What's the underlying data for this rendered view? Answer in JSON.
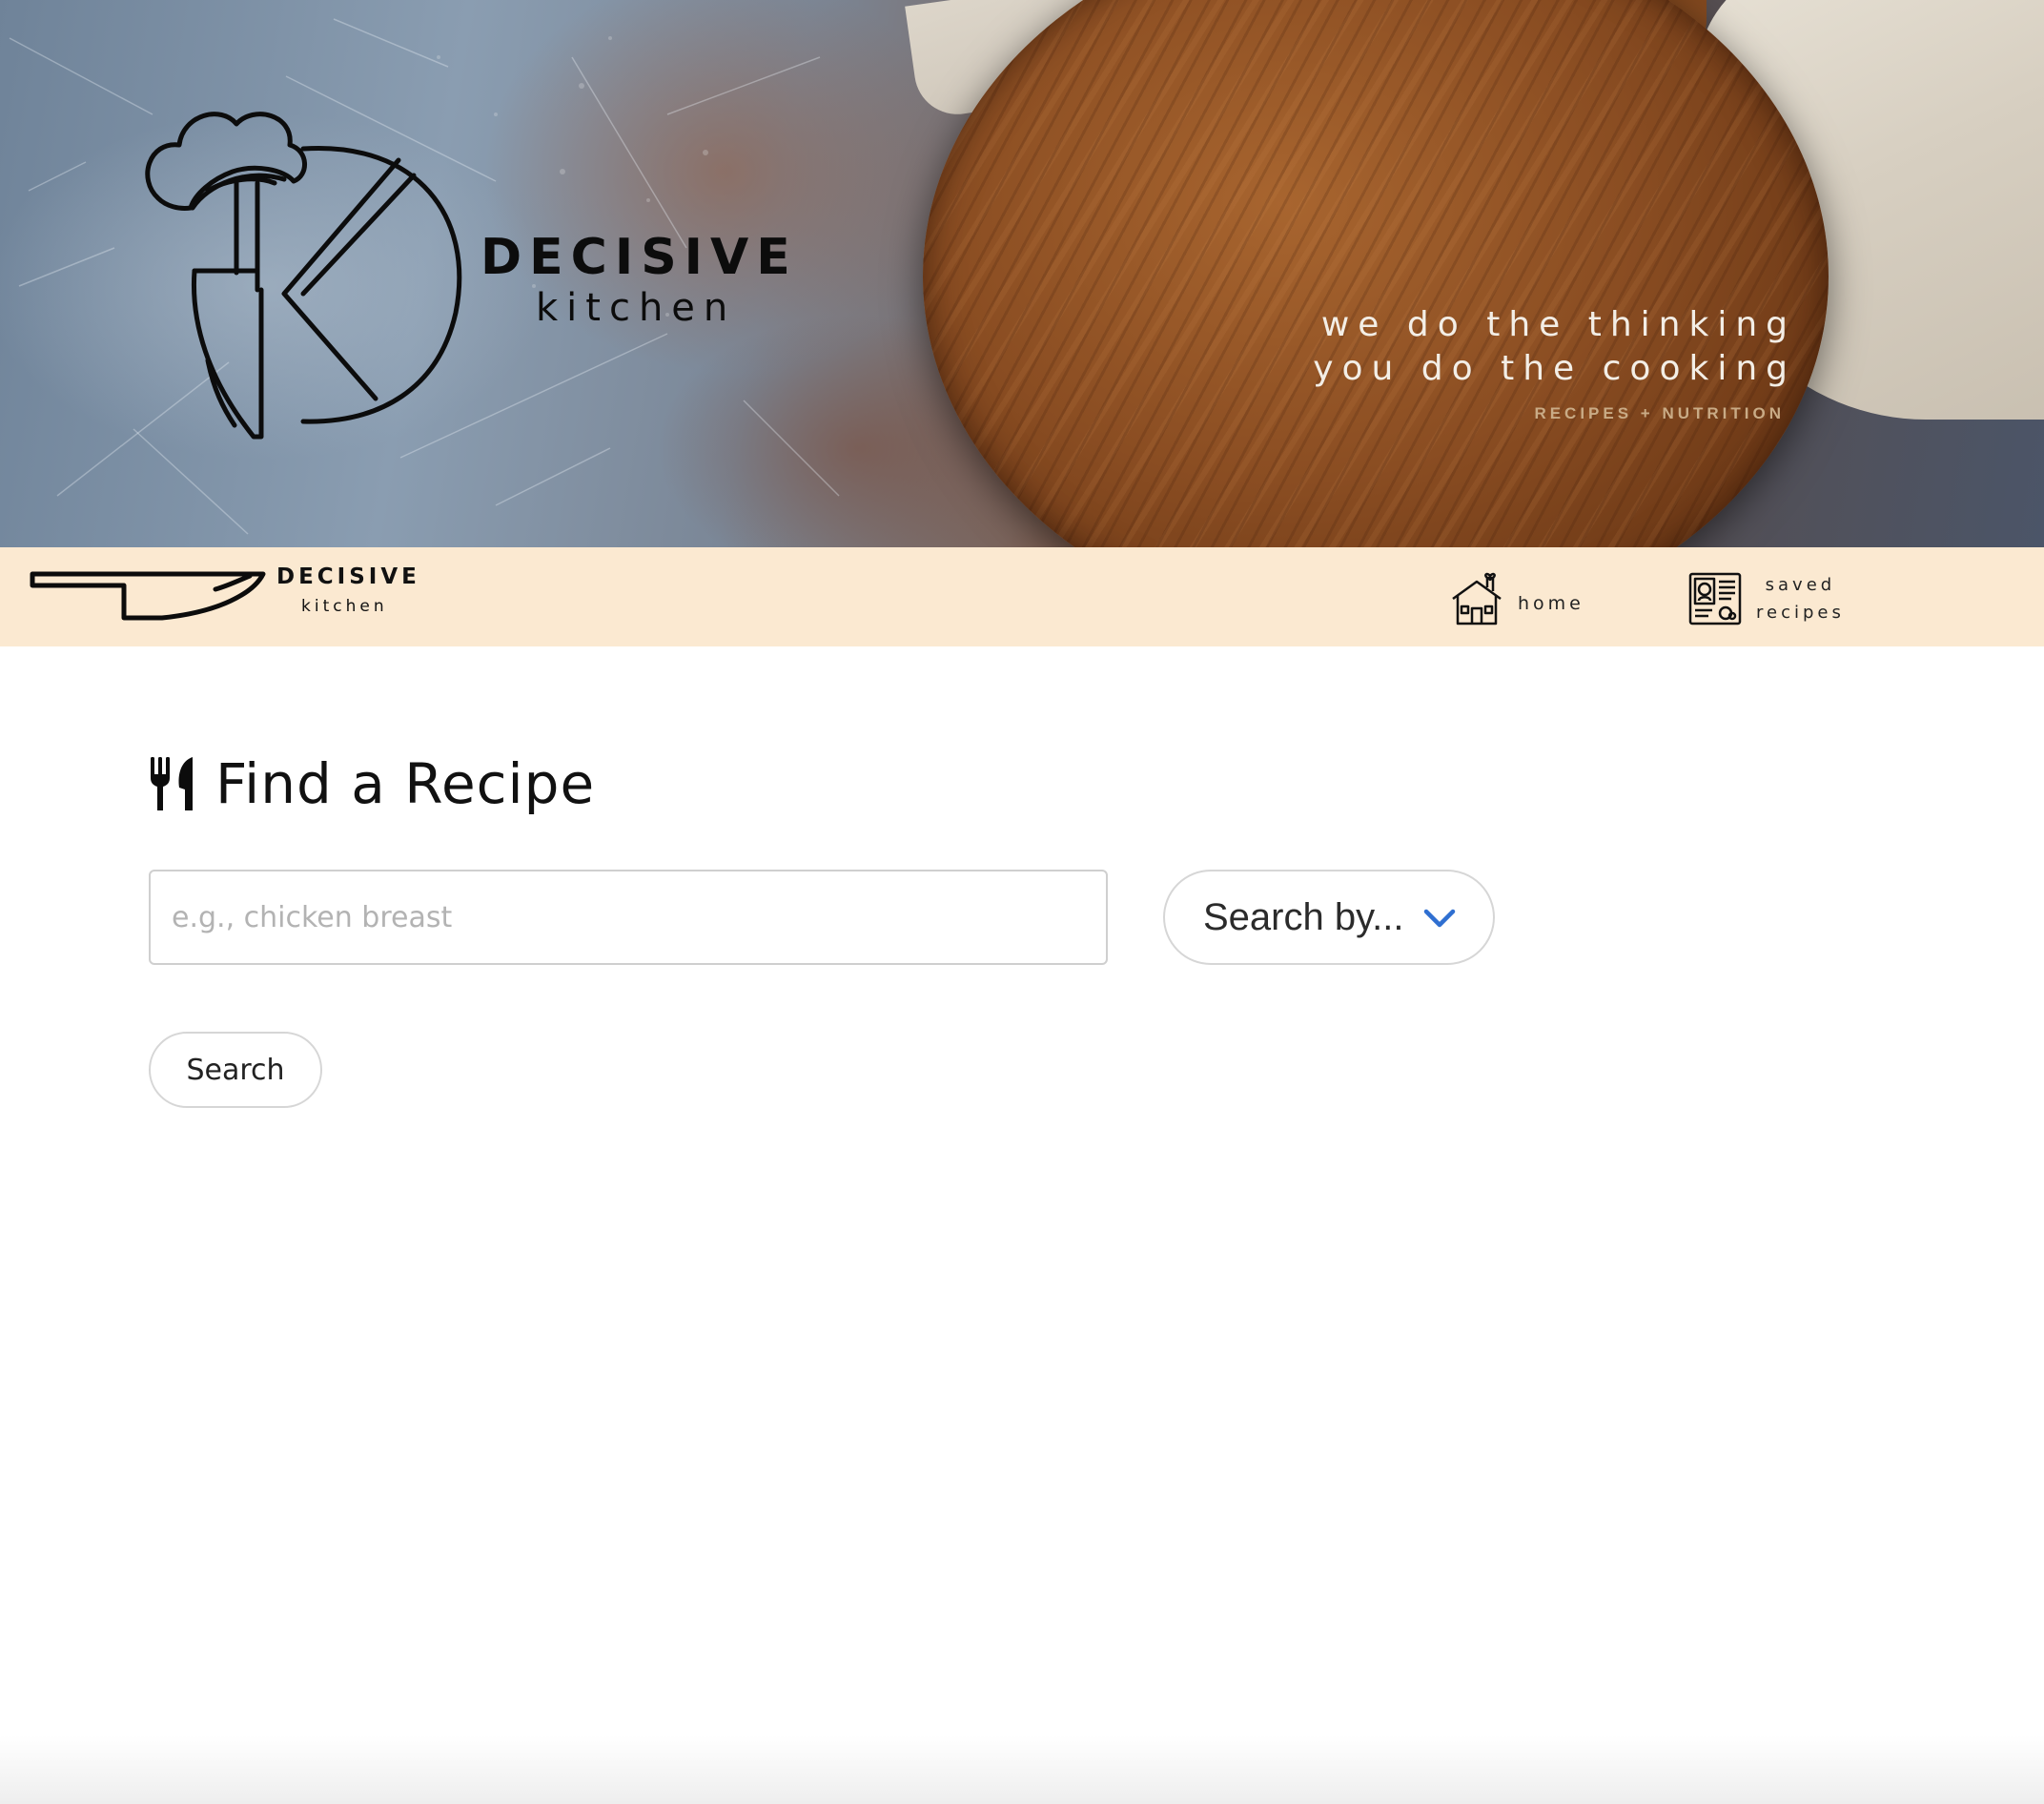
{
  "hero": {
    "brand_line_1": "DECISIVE",
    "brand_line_2": "kitchen",
    "tagline_1": "we do the thinking",
    "tagline_2": "you do the cooking",
    "tagline_3": "RECIPES + NUTRITION"
  },
  "navbar": {
    "brand_line_1": "DECISIVE",
    "brand_line_2": "kitchen",
    "home_label": "home",
    "saved_label_1": "saved",
    "saved_label_2": "recipes"
  },
  "main": {
    "heading": "Find a Recipe",
    "search_placeholder": "e.g., chicken breast",
    "search_value": "",
    "search_by_label": "Search by...",
    "search_button_label": "Search"
  },
  "icons": {
    "heading_icon": "utensils-icon",
    "home_icon": "house-icon",
    "saved_icon": "recipe-card-icon",
    "dropdown_icon": "chevron-down-icon",
    "nav_logo_icon": "knife-icon"
  },
  "colors": {
    "navbar_bg": "#fbe9d1",
    "tagline_accent": "#c9ab86",
    "chevron": "#2f6fd1"
  }
}
